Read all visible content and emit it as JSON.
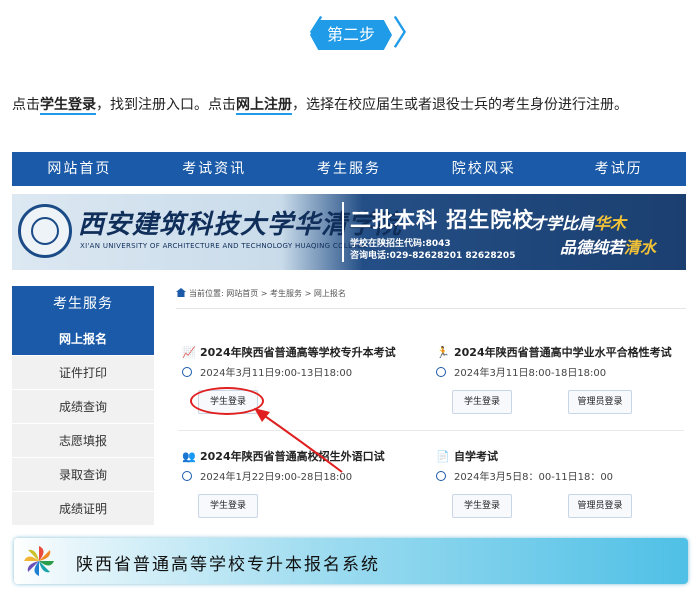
{
  "step": {
    "label": "第二步",
    "left_chevron": "〈",
    "right_chevron": "〉"
  },
  "instruction": {
    "p1": "点击",
    "b1": "学生登录",
    "p2": "，找到注册入口。点击",
    "b2": "网上注册",
    "p3": "，选择在校应届生或者退役士兵的考生身份进行注册。"
  },
  "nav": {
    "items": [
      "网站首页",
      "考试资讯",
      "考生服务",
      "院校风采",
      "考试历"
    ]
  },
  "banner": {
    "school_name": "西安建筑科技大学华清学院",
    "school_name_en": "XI'AN UNIVERSITY OF ARCHITECTURE AND TECHNOLOGY HUAQING COLLEGE",
    "title": "二批本科  招生院校",
    "code": "学校在陕招生代码:8043",
    "phone": "咨询电话:029-82628201  82628205",
    "slogan1_a": "才学比肩",
    "slogan1_b": "华木",
    "slogan2_a": "品德纯若",
    "slogan2_b": "清水"
  },
  "sidebar": {
    "header": "考生服务",
    "items": [
      "网上报名",
      "证件打印",
      "成绩查询",
      "志愿填报",
      "录取查询",
      "成绩证明"
    ]
  },
  "breadcrumb": "当前位置: 网站首页 > 考生服务 > 网上报名",
  "cards": [
    {
      "icon": "📈",
      "title": "2024年陕西省普通高等学校专升本考试",
      "time": "2024年3月11日9:00-13日18:00",
      "btn1": "学生登录"
    },
    {
      "icon": "🏃",
      "title": "2024年陕西省普通高中学业水平合格性考试",
      "time": "2024年3月11日8:00-18日18:00",
      "btn1": "学生登录",
      "btn2": "管理员登录"
    },
    {
      "icon": "👥",
      "title": "2024年陕西省普通高校招生外语口试",
      "time": "2024年1月22日9:00-28日18:00",
      "btn1": "学生登录"
    },
    {
      "icon": "📄",
      "title": "自学考试",
      "time": "2024年3月5日8：00-11日18：00",
      "btn1": "学生登录",
      "btn2": "管理员登录"
    }
  ],
  "footer": {
    "title": "陕西省普通高等学校专升本报名系统"
  },
  "colors": {
    "accent": "#1f9be8",
    "nav_blue": "#1a5aa8",
    "highlight_red": "#e02020"
  }
}
